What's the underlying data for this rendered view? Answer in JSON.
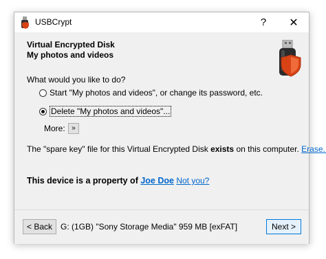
{
  "window": {
    "title": "USBCrypt",
    "help_label": "?",
    "close_label": "✕"
  },
  "header": {
    "line1": "Virtual Encrypted Disk",
    "line2": "My photos and videos"
  },
  "prompt": {
    "question": "What would you like to do?",
    "options": [
      {
        "label": "Start \"My photos and videos\", or change its password, etc.",
        "selected": false
      },
      {
        "label": "Delete \"My photos and videos\"...",
        "selected": true
      }
    ],
    "more_label": "More:",
    "more_button": "»"
  },
  "spare_key": {
    "prefix": "The \"spare key\" file for this Virtual Encrypted Disk ",
    "status": "exists",
    "suffix": " on this computer. ",
    "erase_link": "Erase..."
  },
  "property": {
    "text": "This device is a property of ",
    "owner": "Joe Doe",
    "not_you": "Not you?"
  },
  "footer": {
    "back_label": "< Back",
    "device": "G: (1GB) \"Sony Storage Media\" 959 MB [exFAT]",
    "next_label": "Next >"
  },
  "colors": {
    "link": "#0066cc",
    "shield": "#d84315",
    "next_border": "#0078d7"
  }
}
